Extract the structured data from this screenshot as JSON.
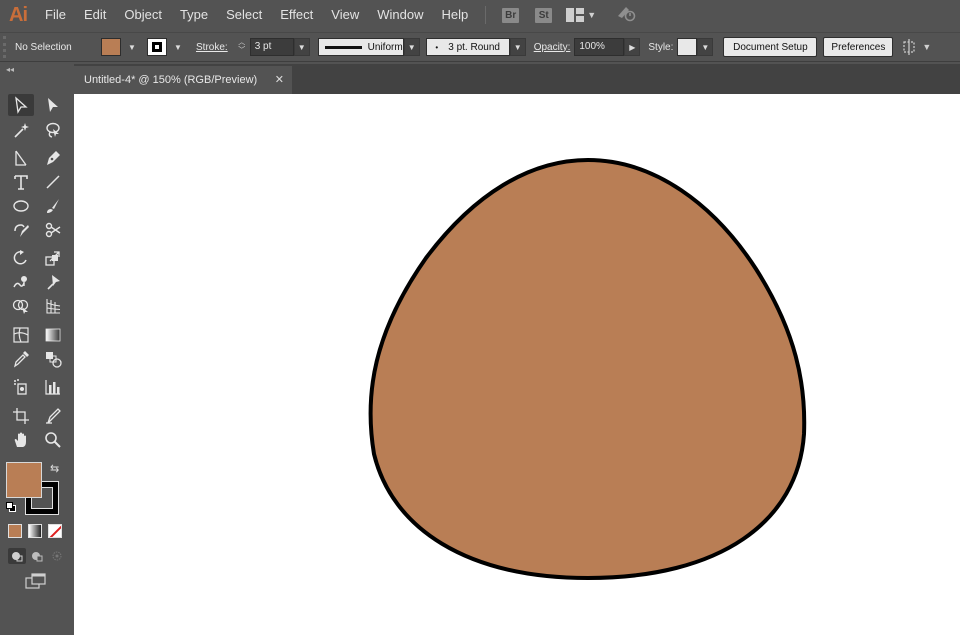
{
  "app": {
    "logo": "Ai"
  },
  "menu": [
    "File",
    "Edit",
    "Object",
    "Type",
    "Select",
    "Effect",
    "View",
    "Window",
    "Help"
  ],
  "bridge_label": "Br",
  "stock_label": "St",
  "control": {
    "selection_status": "No Selection",
    "stroke_label": "Stroke:",
    "stroke_weight": "3 pt",
    "profile": "Uniform",
    "brush": "3 pt. Round",
    "opacity_label": "Opacity:",
    "opacity": "100%",
    "style_label": "Style:",
    "document_setup": "Document Setup",
    "preferences": "Preferences"
  },
  "document": {
    "tab_title": "Untitled-4* @ 150% (RGB/Preview)",
    "close_glyph": "✕"
  },
  "colors": {
    "fill": "#b97e55",
    "stroke": "#000000",
    "canvas": "#ffffff",
    "chrome": "#535353"
  },
  "tools": [
    "selection-tool-icon",
    "direct-selection-tool-icon",
    "magic-wand-tool-icon",
    "lasso-tool-icon",
    "line-segment-icon",
    "pen-tool-icon",
    "type-tool-icon",
    "line-tool-icon",
    "ellipse-tool-icon",
    "paintbrush-tool-icon",
    "shaper-tool-icon",
    "scissors-tool-icon",
    "rotate-tool-icon",
    "scale-tool-icon",
    "warp-tool-icon",
    "puppet-warp-tool-icon",
    "shape-builder-tool-icon",
    "perspective-grid-tool-icon",
    "mesh-tool-icon",
    "gradient-tool-icon",
    "eyedropper-tool-icon",
    "blend-tool-icon",
    "symbol-sprayer-tool-icon",
    "column-graph-tool-icon",
    "artboard-tool-icon",
    "slice-tool-icon",
    "hand-tool-icon",
    "zoom-tool-icon"
  ]
}
